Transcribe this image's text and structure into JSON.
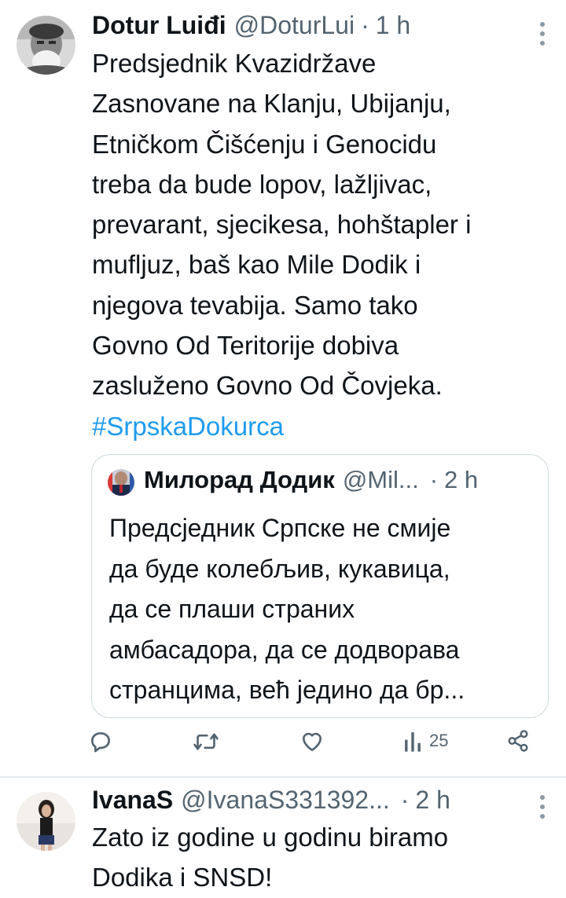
{
  "tweet1": {
    "name": "Dotur Luiđi",
    "handle": "@DoturLui",
    "dot": "·",
    "time": "1 h",
    "lines": [
      "Predsjednik Kvazidržave",
      "Zasnovane na Klanju, Ubijanju,",
      "Etničkom Čišćenju i Genocidu",
      "treba da bude lopov, lažljivac,",
      "prevarant, sjecikesa, hohštapler i",
      "mufljuz, baš kao Mile Dodik i",
      "njegova tevabija. Samo tako",
      "Govno Od Teritorije dobiva",
      "zasluženo Govno Od Čovjeka."
    ],
    "hashtag": "#SrpskaDokurca",
    "quote": {
      "name": "Милорад Додик",
      "handle": "@Mil...",
      "dot": "·",
      "time": "2 h",
      "lines": [
        "Предсједник Српске не смије",
        "да буде колебљив, кукавица,",
        "да се плаши страних",
        "амбасадора, да се додворава",
        "странцима, већ једино да бр..."
      ]
    },
    "actions": {
      "reply_icon": "reply-icon",
      "retweet_icon": "retweet-icon",
      "like_icon": "heart-icon",
      "views_icon": "views-icon",
      "views_count": "25",
      "share_icon": "share-icon"
    }
  },
  "tweet2": {
    "name": "IvanaS",
    "handle": "@IvanaS331392...",
    "dot": "·",
    "time": "2 h",
    "lines": [
      "Zato iz godine u godinu biramo",
      "Dodika i SNSD!"
    ]
  },
  "colors": {
    "text": "#0f1419",
    "secondary": "#536471",
    "link": "#1d9bf0",
    "border": "#cfd9de"
  }
}
